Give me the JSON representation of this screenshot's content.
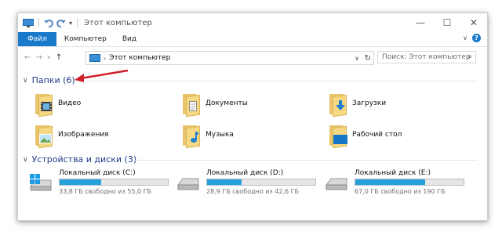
{
  "window": {
    "title": "Этот компьютер",
    "controls": {
      "minimize": "—",
      "maximize": "☐",
      "close": "✕"
    }
  },
  "ribbon": {
    "tabs": [
      "Файл",
      "Компьютер",
      "Вид"
    ],
    "help_icon": "?"
  },
  "address": {
    "path": "Этот компьютер",
    "search_placeholder": "Поиск: Этот компьютер"
  },
  "folders_group": {
    "title": "Папки (6)",
    "items": [
      {
        "label": "Видео",
        "icon": "video-folder-icon"
      },
      {
        "label": "Документы",
        "icon": "documents-folder-icon"
      },
      {
        "label": "Загрузки",
        "icon": "downloads-folder-icon"
      },
      {
        "label": "Изображения",
        "icon": "pictures-folder-icon"
      },
      {
        "label": "Музыка",
        "icon": "music-folder-icon"
      },
      {
        "label": "Рабочий стол",
        "icon": "desktop-folder-icon"
      }
    ]
  },
  "drives_group": {
    "title": "Устройства и диски (3)",
    "items": [
      {
        "name": "Локальный диск (C:)",
        "free_text": "33,8 ГБ свободно из 55,0 ГБ",
        "used_fraction": 0.385,
        "icon": "system-drive-icon"
      },
      {
        "name": "Локальный диск (D:)",
        "free_text": "28,9 ГБ свободно из 42,6 ГБ",
        "used_fraction": 0.322,
        "icon": "hard-drive-icon"
      },
      {
        "name": "Локальный диск (E:)",
        "free_text": "67,0 ГБ свободно из 190 ГБ",
        "used_fraction": 0.647,
        "icon": "hard-drive-icon"
      }
    ]
  },
  "colors": {
    "accent": "#1979ca",
    "group_title": "#1e3a8a",
    "progress": "#26a0da",
    "annotation_arrow": "#d0202a"
  }
}
